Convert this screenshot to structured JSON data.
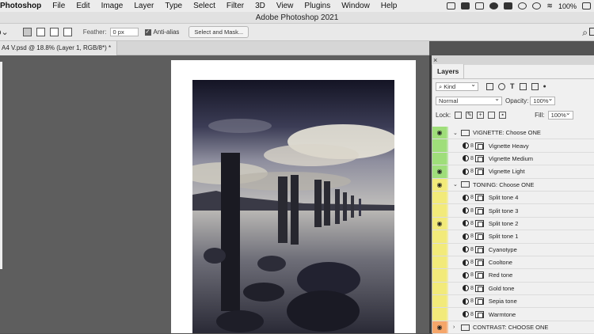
{
  "menubar": {
    "app_name": "Photoshop",
    "items": [
      "File",
      "Edit",
      "Image",
      "Layer",
      "Type",
      "Select",
      "Filter",
      "3D",
      "View",
      "Plugins",
      "Window",
      "Help"
    ],
    "battery": "100%"
  },
  "title": "Adobe Photoshop 2021",
  "options": {
    "feather_label": "Feather:",
    "feather_value": "0 px",
    "antialias_label": "Anti-alias",
    "select_mask_label": "Select and Mask..."
  },
  "document_tab": {
    "label": "A4 V.psd @ 18.8% (Layer 1, RGB/8*) *",
    "close": "×"
  },
  "panel": {
    "close": "×",
    "tab_label": "Layers",
    "kind_label": "Kind",
    "blend_mode": "Normal",
    "opacity_label": "Opacity:",
    "opacity_value": "100%",
    "lock_label": "Lock:",
    "fill_label": "Fill:",
    "fill_value": "100%"
  },
  "layers": [
    {
      "name": "VIGNETTE: Choose ONE",
      "group": true,
      "expanded": true,
      "visible": true,
      "color": "#9fde7a"
    },
    {
      "name": "Vignette Heavy",
      "group": false,
      "visible": false,
      "color": "#9fde7a"
    },
    {
      "name": "Vignette Medium",
      "group": false,
      "visible": false,
      "color": "#9fde7a"
    },
    {
      "name": "Vignette Light",
      "group": false,
      "visible": true,
      "color": "#9fde7a"
    },
    {
      "name": "TONING: Choose ONE",
      "group": true,
      "expanded": true,
      "visible": true,
      "color": "#f2ea7a"
    },
    {
      "name": "Split tone 4",
      "group": false,
      "visible": false,
      "color": "#f2ea7a"
    },
    {
      "name": "Split tone 3",
      "group": false,
      "visible": false,
      "color": "#f2ea7a"
    },
    {
      "name": "Split tone 2",
      "group": false,
      "visible": true,
      "color": "#f2ea7a"
    },
    {
      "name": "Split tone 1",
      "group": false,
      "visible": false,
      "color": "#f2ea7a"
    },
    {
      "name": "Cyanotype",
      "group": false,
      "visible": false,
      "color": "#f2ea7a"
    },
    {
      "name": "Cooltone",
      "group": false,
      "visible": false,
      "color": "#f2ea7a"
    },
    {
      "name": "Red tone",
      "group": false,
      "visible": false,
      "color": "#f2ea7a"
    },
    {
      "name": "Gold tone",
      "group": false,
      "visible": false,
      "color": "#f2ea7a"
    },
    {
      "name": "Sepia tone",
      "group": false,
      "visible": false,
      "color": "#f2ea7a"
    },
    {
      "name": "Warmtone",
      "group": false,
      "visible": false,
      "color": "#f2ea7a"
    },
    {
      "name": "CONTRAST: CHOOSE ONE",
      "group": true,
      "expanded": false,
      "visible": true,
      "color": "#f5a66a"
    }
  ],
  "icons": {
    "eye": "eye-icon",
    "folder": "folder-icon",
    "search": "search-icon"
  }
}
